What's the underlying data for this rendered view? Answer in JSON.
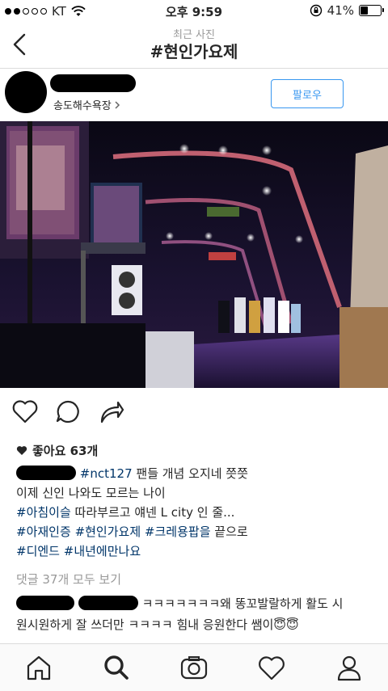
{
  "status": {
    "carrier": "KT",
    "time": "오후 9:59",
    "battery": "41%",
    "battery_level": 0.41
  },
  "nav": {
    "subtitle": "최근 사진",
    "title": "#현인가요제"
  },
  "post": {
    "location": "송도해수욕장",
    "follow_label": "팔로우",
    "likes": "좋아요 63개",
    "caption": {
      "line1_tag": "#nct127",
      "line1_text": " 팬들 개념 오지네 쯧쯧",
      "line2": "이제 신인 나와도 모르는 나이",
      "line3_tag": "#아침이슬",
      "line3_text": " 따라부르고 얘넨 L city 인 줄...",
      "line4_tag1": "#아재인증",
      "line4_tag2": "#현인가요제",
      "line4_tag3": "#크레용팝을",
      "line4_text": " 끝으로",
      "line5_tag1": "#디엔드",
      "line5_tag2": "#내년에만나요"
    },
    "comments_link": "댓글 37개 모두 보기",
    "comment": {
      "line1": "ㅋㅋㅋㅋㅋㅋㅋ왜 똥꼬발랄하게 활도 시",
      "line2": "원시원하게 잘 쓰더만 ㅋㅋㅋㅋ 힘내 응원한다 쌤이",
      "emoji": "😇😇"
    }
  },
  "colors": {
    "link_blue": "#3897f0",
    "hashtag": "#003569",
    "muted": "#999999",
    "divider": "#dbdbdb"
  },
  "icons": [
    "back-chevron-icon",
    "heart-icon",
    "comment-icon",
    "share-icon",
    "home-icon",
    "search-icon",
    "camera-icon",
    "activity-heart-icon",
    "profile-icon"
  ]
}
